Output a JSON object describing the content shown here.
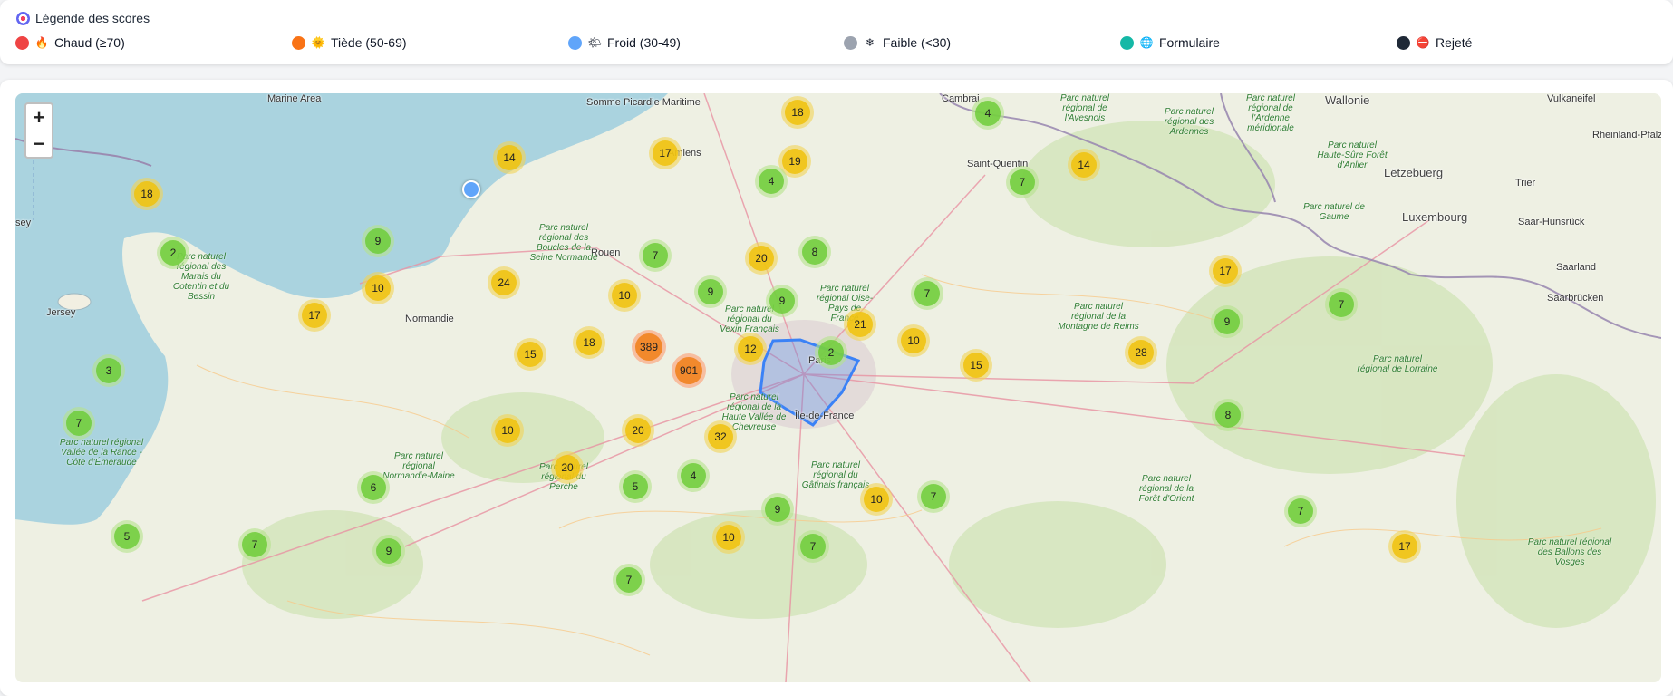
{
  "legend": {
    "title": "Légende des scores",
    "title_icon": "target-icon",
    "items": [
      {
        "label": "Chaud (≥70)",
        "dot_color": "#ef4444",
        "icon": "fire-icon",
        "glyph": "🔥"
      },
      {
        "label": "Tiède (50-69)",
        "dot_color": "#f97316",
        "icon": "sun-icon",
        "glyph": "🌞"
      },
      {
        "label": "Froid (30-49)",
        "dot_color": "#60a5fa",
        "icon": "sun-cloud-icon",
        "glyph": "🌤"
      },
      {
        "label": "Faible (<30)",
        "dot_color": "#9ca3af",
        "icon": "snowflake-icon",
        "glyph": "❄"
      },
      {
        "label": "Formulaire",
        "dot_color": "#14b8a6",
        "icon": "globe-icon",
        "glyph": "🌐"
      },
      {
        "label": "Rejeté",
        "dot_color": "#1f2937",
        "icon": "no-entry-icon",
        "glyph": "⛔"
      }
    ]
  },
  "map": {
    "zoom_in": "+",
    "zoom_out": "−",
    "places": [
      "Marine Area",
      "Somme Picardie Maritime",
      "Amiens",
      "Cambrai",
      "Saint-Quentin",
      "Rouen",
      "Normandie",
      "Jersey",
      "sey",
      "Île-de-France",
      "Paris",
      "Wallonie",
      "Lëtzebuerg",
      "Luxembourg",
      "Trier",
      "Rheinland-Pfalz",
      "Saar-Hunsrück",
      "Saarland",
      "Vulkaneifel",
      "Saarbrücken"
    ],
    "parks": [
      "Parc naturel régional des Boucles de la Seine Normande",
      "Parc naturel régional des Marais du Cotentin et du Bessin",
      "Parc naturel régional du Vexin Français",
      "Parc naturel régional Oise-Pays de France",
      "Parc naturel régional de la Haute Vallée de Chevreuse",
      "Parc naturel régional du Gâtinais français",
      "Parc naturel régional Normandie-Maine",
      "Parc naturel régional du Perche",
      "Parc naturel régional Vallée de la Rance - Côte d'Émeraude",
      "Parc naturel régional de la Montagne de Reims",
      "Parc naturel régional de la Forêt d'Orient",
      "Parc naturel régional de Lorraine",
      "Parc naturel régional des Ballons des Vosges",
      "Parc naturel régional des Ardennes",
      "Parc naturel régional de l'Ardenne méridionale",
      "Parc naturel Haute-Sûre Forêt d'Anlier",
      "Parc naturel de Gaume",
      "Parc naturel régional de l'Avesnois"
    ],
    "clusters": [
      {
        "count": "14",
        "size": "medium"
      },
      {
        "count": "17",
        "size": "medium"
      },
      {
        "count": "18",
        "size": "medium"
      },
      {
        "count": "19",
        "size": "medium"
      },
      {
        "count": "4",
        "size": "small"
      },
      {
        "count": "4",
        "size": "small"
      },
      {
        "count": "18",
        "size": "medium"
      },
      {
        "count": "7",
        "size": "small"
      },
      {
        "count": "14",
        "size": "medium"
      },
      {
        "count": "2",
        "size": "small"
      },
      {
        "count": "9",
        "size": "small"
      },
      {
        "count": "24",
        "size": "medium"
      },
      {
        "count": "10",
        "size": "medium"
      },
      {
        "count": "7",
        "size": "small"
      },
      {
        "count": "20",
        "size": "medium"
      },
      {
        "count": "8",
        "size": "small"
      },
      {
        "count": "17",
        "size": "medium"
      },
      {
        "count": "17",
        "size": "medium"
      },
      {
        "count": "10",
        "size": "medium"
      },
      {
        "count": "9",
        "size": "small"
      },
      {
        "count": "9",
        "size": "small"
      },
      {
        "count": "7",
        "size": "small"
      },
      {
        "count": "7",
        "size": "small"
      },
      {
        "count": "9",
        "size": "small"
      },
      {
        "count": "389",
        "size": "large"
      },
      {
        "count": "18",
        "size": "medium"
      },
      {
        "count": "15",
        "size": "medium"
      },
      {
        "count": "3",
        "size": "small"
      },
      {
        "count": "901",
        "size": "large"
      },
      {
        "count": "12",
        "size": "medium"
      },
      {
        "count": "2",
        "size": "small"
      },
      {
        "count": "21",
        "size": "medium"
      },
      {
        "count": "10",
        "size": "medium"
      },
      {
        "count": "15",
        "size": "medium"
      },
      {
        "count": "28",
        "size": "medium"
      },
      {
        "count": "7",
        "size": "small"
      },
      {
        "count": "10",
        "size": "medium"
      },
      {
        "count": "20",
        "size": "medium"
      },
      {
        "count": "32",
        "size": "medium"
      },
      {
        "count": "8",
        "size": "small"
      },
      {
        "count": "20",
        "size": "medium"
      },
      {
        "count": "4",
        "size": "small"
      },
      {
        "count": "6",
        "size": "small"
      },
      {
        "count": "5",
        "size": "small"
      },
      {
        "count": "9",
        "size": "small"
      },
      {
        "count": "10",
        "size": "medium"
      },
      {
        "count": "7",
        "size": "small"
      },
      {
        "count": "7",
        "size": "small"
      },
      {
        "count": "5",
        "size": "small"
      },
      {
        "count": "7",
        "size": "small"
      },
      {
        "count": "9",
        "size": "small"
      },
      {
        "count": "10",
        "size": "medium"
      },
      {
        "count": "7",
        "size": "small"
      },
      {
        "count": "7",
        "size": "small"
      },
      {
        "count": "17",
        "size": "medium"
      }
    ],
    "selected_area_color": "#3b82f6",
    "single_lead_color": "#60a5fa"
  }
}
